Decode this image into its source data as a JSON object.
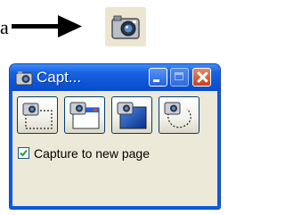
{
  "caption_fragment": "a",
  "icons": {
    "arrow": "right-arrow-icon",
    "tray": "camera-icon",
    "title": "camera-icon"
  },
  "window": {
    "title": "Capt...",
    "controls": [
      "minimize",
      "maximize-disabled",
      "close"
    ],
    "capture_buttons": [
      {
        "name": "capture-region-button",
        "icon": "region-capture-icon"
      },
      {
        "name": "capture-window-button",
        "icon": "window-capture-icon"
      },
      {
        "name": "capture-fullscreen-button",
        "icon": "fullscreen-capture-icon"
      },
      {
        "name": "capture-freeform-button",
        "icon": "freeform-capture-icon"
      }
    ],
    "checkbox": {
      "label": "Capture to new page",
      "checked": true
    }
  },
  "colors": {
    "titlebar": "#0c55d6",
    "client": "#ece9d8",
    "close_button": "#c4401d",
    "check_mark": "#21a121",
    "tray_bg": "#ece5cf"
  }
}
